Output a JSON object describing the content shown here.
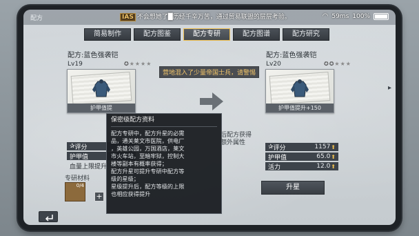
{
  "window_title": "配方",
  "notice": {
    "tag": "IAS",
    "text": "不会想她了█历经千辛万苦，通过贸易联盟的层层考验。"
  },
  "status": {
    "wifi_icon": "wifi-icon",
    "latency": "59ms",
    "battery_percent": "100%"
  },
  "tabs": [
    {
      "label": "简易制作",
      "active": false
    },
    {
      "label": "配方图鉴",
      "active": false
    },
    {
      "label": "配方专研",
      "active": true
    },
    {
      "label": "配方图谱",
      "active": false
    },
    {
      "label": "配方研究",
      "active": false
    }
  ],
  "left_card": {
    "title": "配方:蓝色强袭铠",
    "level": "Lv19",
    "stars_filled": 1,
    "stars_total": 5,
    "caption": "护甲值提",
    "rating_label": "评分",
    "stat_label": "护甲值",
    "limit_text": "血量上限提升"
  },
  "right_card": {
    "title": "配方:蓝色强袭铠",
    "level": "Lv20",
    "stars_filled": 2,
    "stars_total": 5,
    "caption": "护甲值提升+150",
    "stats": [
      {
        "label": "评分",
        "value": "1157"
      },
      {
        "label": "护甲值",
        "value": "65.0"
      },
      {
        "label": "活力",
        "value": "12.0"
      }
    ]
  },
  "warning": "营地混入了少量帝国士兵，请警惕",
  "mid_text": [
    "后配方获得",
    "额外属性"
  ],
  "material": {
    "label": "专研材料",
    "count": "0/4"
  },
  "promote_button": "升星",
  "tooltip": {
    "title": "保密级配方资料",
    "lines": [
      "配方专研中，配方升星的必需",
      "品，通关莱文市医院，供电厂",
      "，英雄公园，万国酒店，莱文",
      "市火车站，至暗牢狱，控制大",
      "楼等副本有概率获得；",
      "配方升星可提升专研中配方等",
      "级的星级；",
      "星级提升后，配方等级的上限",
      "也相应获得提升"
    ]
  },
  "colors": {
    "accent": "#f0c050",
    "panel": "#3d434a"
  }
}
